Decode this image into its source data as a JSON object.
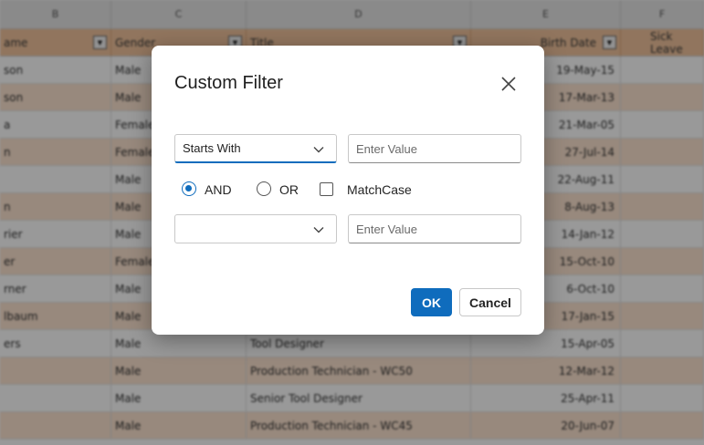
{
  "sheet": {
    "column_letters": [
      "B",
      "C",
      "D",
      "E",
      "F"
    ],
    "headers": [
      "ame",
      "Gender",
      "Title",
      "Birth Date",
      "Sick Leave"
    ],
    "rows": [
      [
        "son",
        "Male",
        "",
        "19-May-15",
        ""
      ],
      [
        "son",
        "Male",
        "",
        "17-Mar-13",
        ""
      ],
      [
        "a",
        "Female",
        "",
        "21-Mar-05",
        ""
      ],
      [
        "n",
        "Female",
        "",
        "27-Jul-14",
        ""
      ],
      [
        "",
        "Male",
        "",
        "22-Aug-11",
        ""
      ],
      [
        "n",
        "Male",
        "",
        "8-Aug-13",
        ""
      ],
      [
        "rier",
        "Male",
        "",
        "14-Jan-12",
        ""
      ],
      [
        "er",
        "Female",
        "",
        "15-Oct-10",
        ""
      ],
      [
        "rner",
        "Male",
        "",
        "6-Oct-10",
        ""
      ],
      [
        "lbaum",
        "Male",
        "",
        "17-Jan-15",
        ""
      ],
      [
        "ers",
        "Male",
        "Tool Designer",
        "15-Apr-05",
        ""
      ],
      [
        "",
        "Male",
        "Production Technician - WC50",
        "12-Mar-12",
        ""
      ],
      [
        "",
        "Male",
        "Senior Tool Designer",
        "25-Apr-11",
        ""
      ],
      [
        "",
        "Male",
        "Production Technician - WC45",
        "20-Jun-07",
        ""
      ]
    ]
  },
  "dialog": {
    "title": "Custom Filter",
    "close_icon": "close-icon",
    "condition1": {
      "operator": "Starts With",
      "value_placeholder": "Enter Value"
    },
    "logic": {
      "and_label": "AND",
      "or_label": "OR",
      "matchcase_label": "MatchCase",
      "selected": "AND",
      "matchcase_checked": false
    },
    "condition2": {
      "operator": "",
      "value_placeholder": "Enter Value"
    },
    "ok_label": "OK",
    "cancel_label": "Cancel"
  },
  "colors": {
    "accent": "#0f6cbd",
    "header_fill": "#f2c49d",
    "alt_row": "#fde4d0"
  }
}
